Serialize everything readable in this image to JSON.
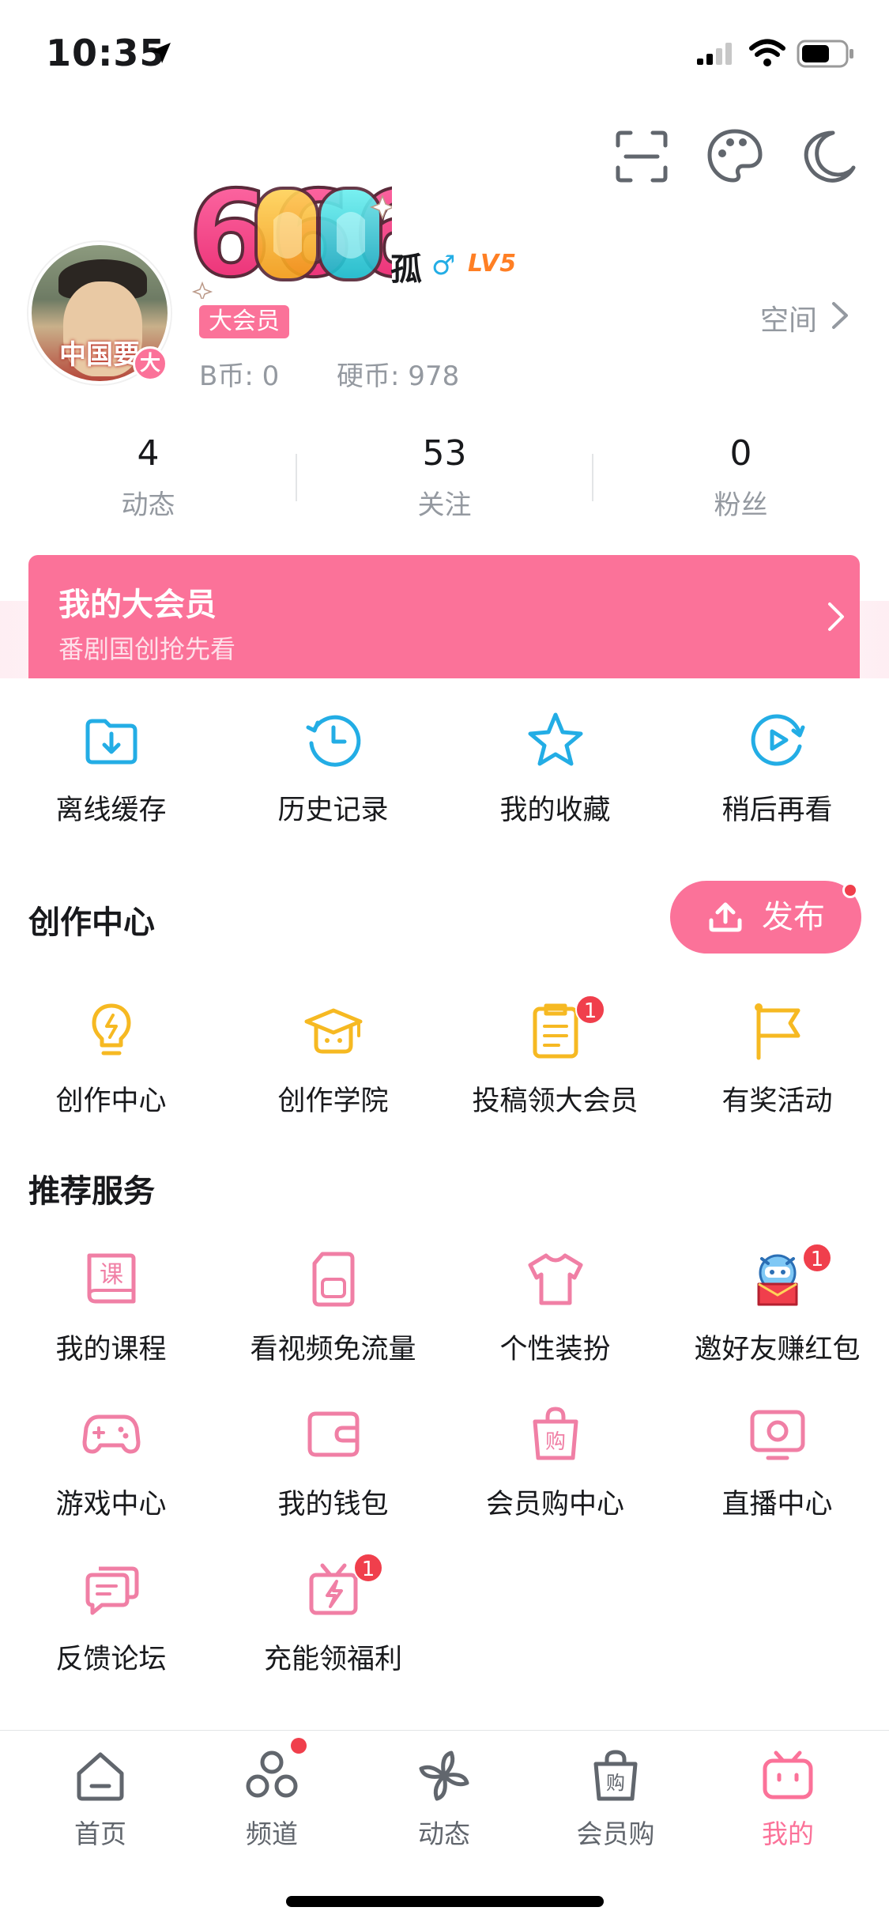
{
  "status": {
    "time": "10:35"
  },
  "profile": {
    "nickname_art": "666",
    "nickname_suffix": "孤",
    "gender_symbol": "♂",
    "level": "LV5",
    "avatar_text": "中国要",
    "avatar_badge": "大",
    "vip_tag": "大会员",
    "bcoin": "B币: 0",
    "coin": "硬币: 978",
    "space_link": "空间"
  },
  "stats": [
    {
      "num": "4",
      "label": "动态"
    },
    {
      "num": "53",
      "label": "关注"
    },
    {
      "num": "0",
      "label": "粉丝"
    }
  ],
  "vip_banner": {
    "title": "我的大会员",
    "subtitle": "番剧国创抢先看"
  },
  "quick": [
    {
      "label": "离线缓存",
      "icon": "download-folder-icon"
    },
    {
      "label": "历史记录",
      "icon": "history-clock-icon"
    },
    {
      "label": "我的收藏",
      "icon": "star-icon"
    },
    {
      "label": "稍后再看",
      "icon": "watch-later-icon"
    }
  ],
  "creation": {
    "title": "创作中心",
    "publish_label": "发布",
    "items": [
      {
        "label": "创作中心",
        "icon": "lightbulb-icon"
      },
      {
        "label": "创作学院",
        "icon": "graduation-cap-icon"
      },
      {
        "label": "投稿领大会员",
        "icon": "clipboard-icon",
        "badge": "1"
      },
      {
        "label": "有奖活动",
        "icon": "flag-icon"
      }
    ]
  },
  "services": {
    "title": "推荐服务",
    "items": [
      {
        "label": "我的课程",
        "icon": "course-book-icon",
        "glyph": "课"
      },
      {
        "label": "看视频免流量",
        "icon": "sim-card-icon"
      },
      {
        "label": "个性装扮",
        "icon": "tshirt-icon"
      },
      {
        "label": "邀好友赚红包",
        "icon": "mascot-red-packet-icon",
        "badge": "1"
      },
      {
        "label": "游戏中心",
        "icon": "gamepad-icon"
      },
      {
        "label": "我的钱包",
        "icon": "wallet-icon"
      },
      {
        "label": "会员购中心",
        "icon": "shopping-bag-icon",
        "glyph": "购"
      },
      {
        "label": "直播中心",
        "icon": "live-tv-icon"
      },
      {
        "label": "反馈论坛",
        "icon": "chat-bubbles-icon"
      },
      {
        "label": "充能领福利",
        "icon": "gift-bolt-icon",
        "badge": "1"
      }
    ]
  },
  "tabs": [
    {
      "label": "首页",
      "icon": "home-icon"
    },
    {
      "label": "频道",
      "icon": "channel-circles-icon"
    },
    {
      "label": "动态",
      "icon": "pinwheel-icon"
    },
    {
      "label": "会员购",
      "icon": "shopping-bag-icon",
      "glyph": "购"
    },
    {
      "label": "我的",
      "icon": "tv-mascot-icon"
    }
  ],
  "colors": {
    "accent": "#fb7299",
    "blue": "#23ade5",
    "gold": "#f6b922",
    "badge": "#f03f4c",
    "text_secondary": "#9499a0"
  }
}
